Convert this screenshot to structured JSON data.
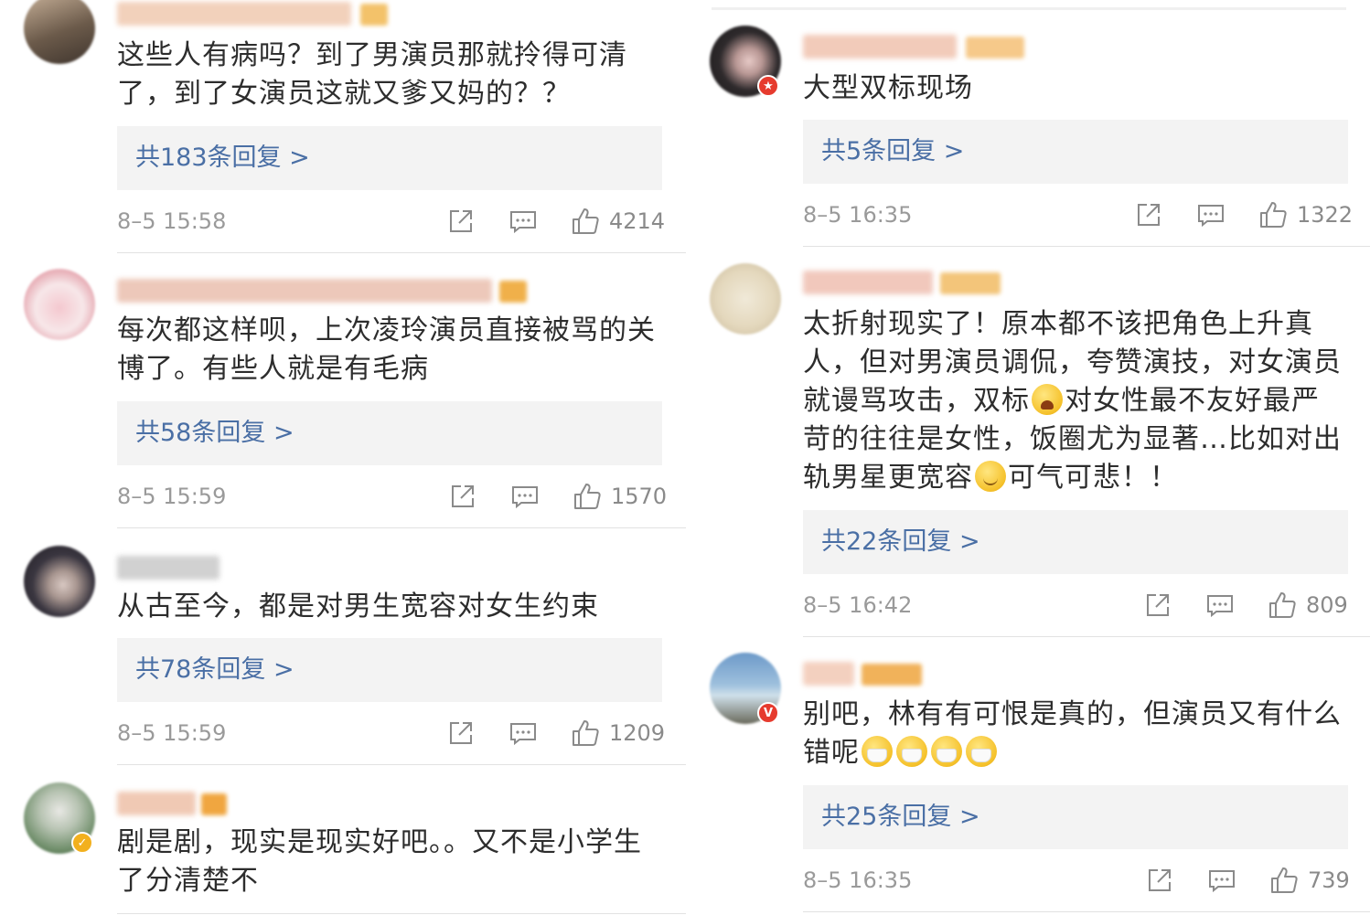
{
  "left": [
    {
      "text_lines": [
        "这些人有病吗？到了男演员那就拎得可清",
        "了，到了女演员这就又爹又妈的？？"
      ],
      "reply": "共183条回复 >",
      "time": "8–5 15:58",
      "likes": "4214",
      "avatar_colors": [
        "#6b5a4a",
        "#c9b29a"
      ],
      "name_color": "#f0c9b0",
      "vip_color": "#f3c26a"
    },
    {
      "text_lines": [
        "每次都这样呗，上次凌玲演员直接被骂的关",
        "博了。有些人就是有毛病"
      ],
      "reply": "共58条回复 >",
      "time": "8–5 15:59",
      "likes": "1570",
      "avatar_colors": [
        "#f4c8cf",
        "#f7e7e9"
      ],
      "name_color": "#eabfae",
      "vip_color": "#f0b04a"
    },
    {
      "text_lines": [
        "从古至今，都是对男生宽容对女生约束"
      ],
      "reply": "共78条回复 >",
      "time": "8–5 15:59",
      "likes": "1209",
      "avatar_colors": [
        "#3a3640",
        "#d8c8c2"
      ],
      "name_color": "#c9c9c9",
      "vip_color": ""
    },
    {
      "text_lines": [
        "剧是剧，现实是现实好吧。。又不是小学生",
        "了分清楚不"
      ],
      "reply": "",
      "time": "",
      "likes": "",
      "avatar_colors": [
        "#6f8e6a",
        "#e8e8e4"
      ],
      "name_color": "#eec0a8",
      "vip_color": "#f0a640"
    }
  ],
  "right": [
    {
      "text_lines": [
        "大型双标现场"
      ],
      "reply": "共5条回复 >",
      "time": "8–5 16:35",
      "likes": "1322",
      "avatar_colors": [
        "#2e2a2c",
        "#e6c9c6"
      ],
      "name_color": "#f0c2ae",
      "vip_color": "#f6c98a"
    },
    {
      "text_lines": [
        "太折射现实了！原本都不该把角色上升真",
        "人，但对男演员调侃，夸赞演技，对女演员",
        "就谩骂攻击，双标 {cry} 对女性最不友好最严",
        "苛的往往是女性，饭圈尤为显著…比如对出",
        "轨男星更宽容 {smile} 可气可悲！！"
      ],
      "reply": "共22条回复 >",
      "time": "8–5 16:42",
      "likes": "809",
      "avatar_colors": [
        "#f0e9d8",
        "#c9b99a"
      ],
      "name_color": "#efbfb1",
      "vip_color": "#f3c57a"
    },
    {
      "text_lines": [
        "别吧，林有有可恨是真的，但演员又有什么",
        "错呢 {mask}{mask}{mask}{mask}"
      ],
      "reply": "共25条回复 >",
      "time": "8–5 16:35",
      "likes": "739",
      "avatar_colors": [
        "#6d9ac9",
        "#cfe0ea"
      ],
      "name_color": "#f2c8b4",
      "vip_color": "#f1b25a"
    }
  ],
  "icons": {
    "share": "share-icon",
    "comment": "comment-icon",
    "like": "thumbs-up-icon"
  },
  "colors": {
    "reply_link": "#4a6fa5",
    "meta_gray": "#9a9a9a",
    "reply_bg": "#f3f3f3"
  }
}
